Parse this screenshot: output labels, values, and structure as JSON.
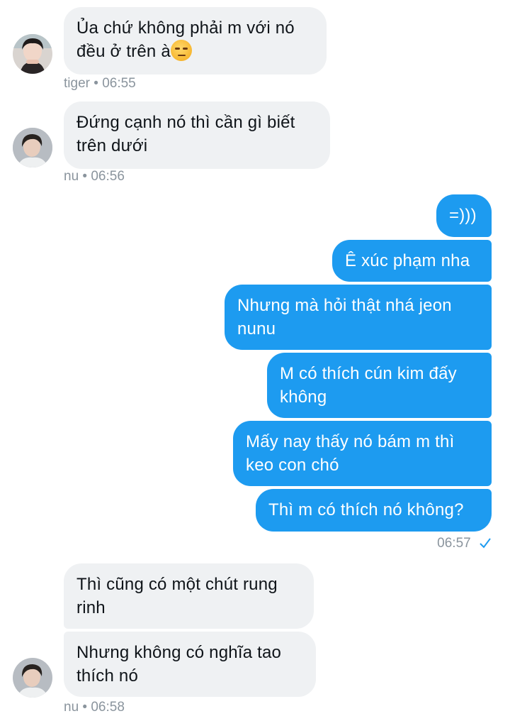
{
  "conversation": {
    "group1": {
      "messages": [
        "Ủa chứ không phải m với nó",
        "đều ở trên à"
      ],
      "emoji": "unamused-face",
      "sender": "tiger",
      "time": "06:55",
      "sep": "•"
    },
    "group2": {
      "messages": [
        "Đứng cạnh nó thì cần gì biết",
        "trên dưới"
      ],
      "sender": "nu",
      "time": "06:56",
      "sep": "•"
    },
    "outgoing": {
      "messages": [
        [
          "=)))"
        ],
        [
          "Ê xúc phạm nha"
        ],
        [
          "Nhưng mà hỏi thật nhá jeon",
          "nunu"
        ],
        [
          "M có thích cún kim đấy",
          "không"
        ],
        [
          "Mấy nay thấy nó bám m thì",
          "keo con chó"
        ],
        [
          "Thì m có thích nó không?"
        ]
      ],
      "time": "06:57",
      "status_icon": "sent-check-icon"
    },
    "group3": {
      "messages": [
        [
          "Thì cũng có một chút rung",
          "rinh"
        ],
        [
          "Nhưng không có nghĩa tao",
          "thích nó"
        ]
      ],
      "sender": "nu",
      "time": "06:58",
      "sep": "•"
    }
  },
  "colors": {
    "outgoing_bubble": "#1d9bf0",
    "incoming_bubble": "#eff1f3",
    "meta_text": "#8a949d"
  }
}
